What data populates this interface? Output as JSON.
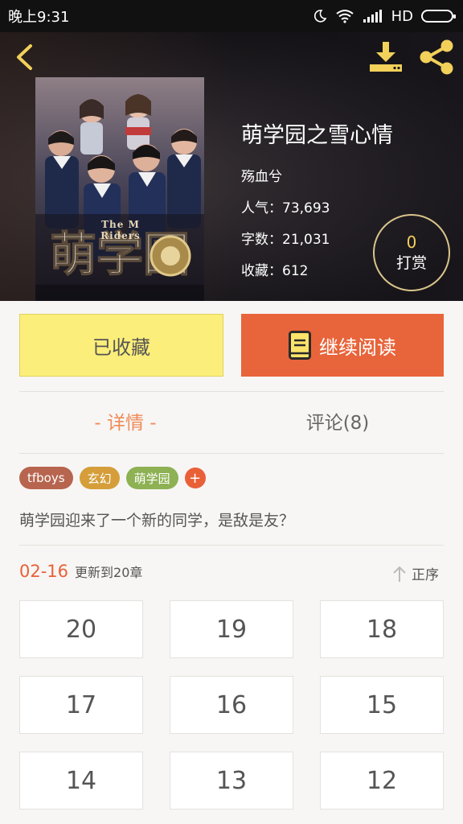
{
  "status_bar": {
    "time": "晚上9:31",
    "network": "HD"
  },
  "header": {
    "back_icon": "chevron-left-icon",
    "download_icon": "download-icon",
    "share_icon": "share-icon",
    "accent_color": "#f2d05a"
  },
  "cover": {
    "title_text": "The M Riders"
  },
  "book": {
    "title": "萌学园之雪心情",
    "author": "殇血兮",
    "popularity": "人气：73,693",
    "word_count": "字数：21,031",
    "favorites": "收藏：612"
  },
  "reward": {
    "count": "0",
    "label": "打赏"
  },
  "actions": {
    "favorited_label": "已收藏",
    "continue_label": "继续阅读",
    "favorited_color": "#fbee7a",
    "continue_color": "#e8643a"
  },
  "tabs": {
    "detail": "- 详情 -",
    "comments": "评论(8)"
  },
  "tags": [
    {
      "label": "tfboys",
      "color": "#b7654f"
    },
    {
      "label": "玄幻",
      "color": "#d59e3a"
    },
    {
      "label": "萌学园",
      "color": "#8db153"
    }
  ],
  "tag_add_label": "+",
  "description": "萌学园迎来了一个新的同学，是敌是友？",
  "update": {
    "date": "02-16",
    "text": "更新到20章"
  },
  "sort": {
    "label": "正序",
    "icon": "arrow-up-icon"
  },
  "chapters": [
    "20",
    "19",
    "18",
    "17",
    "16",
    "15",
    "14",
    "13",
    "12"
  ]
}
